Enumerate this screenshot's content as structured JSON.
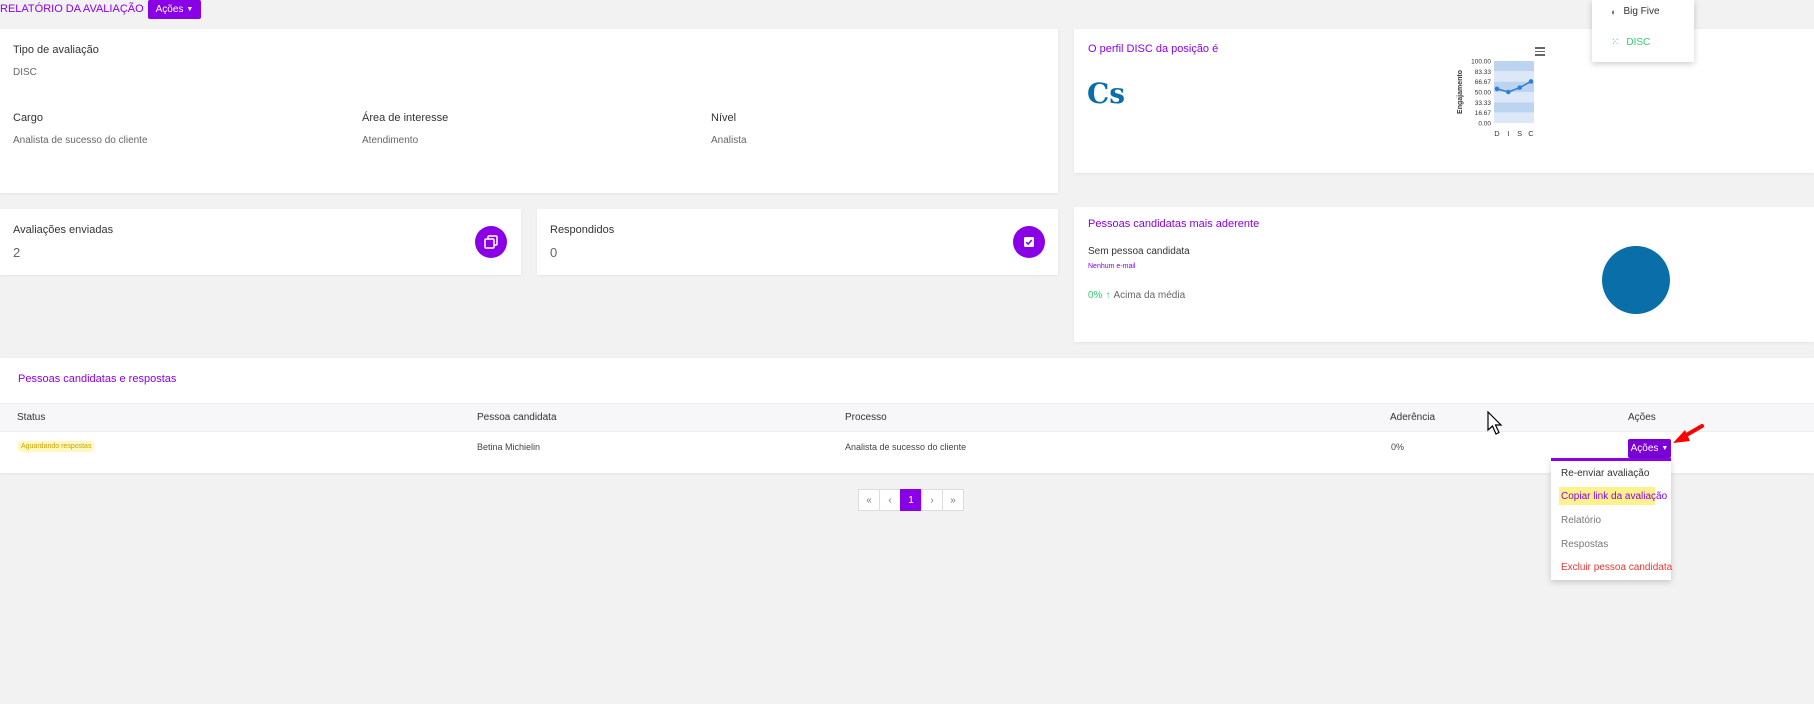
{
  "header": {
    "title": "RELATÓRIO DA AVALIAÇÃO",
    "actions_label": "Ações"
  },
  "info": {
    "tipo_label": "Tipo de avaliação",
    "tipo_value": "DISC",
    "cargo_label": "Cargo",
    "cargo_value": "Analista de sucesso do cliente",
    "area_label": "Área de interesse",
    "area_value": "Atendimento",
    "nivel_label": "Nível",
    "nivel_value": "Analista"
  },
  "disc_card": {
    "title": "O perfil DISC da posição é",
    "profile": "Cs",
    "chart_data": {
      "type": "line",
      "categories": [
        "D",
        "I",
        "S",
        "C"
      ],
      "values": [
        55,
        50,
        57,
        67
      ],
      "ylabel": "Engajamento",
      "yticks": [
        "100.00",
        "83.33",
        "66.67",
        "50.00",
        "33.33",
        "16.67",
        "0.00"
      ],
      "ylim": [
        0,
        100
      ]
    }
  },
  "type_menu": {
    "items": [
      "Big Five",
      "DISC"
    ]
  },
  "stats": {
    "enviadas_label": "Avaliações enviadas",
    "enviadas_value": "2",
    "respondidos_label": "Respondidos",
    "respondidos_value": "0"
  },
  "aderente": {
    "title": "Pessoas candidatas mais aderente",
    "name": "Sem pessoa candidata",
    "email": "Nenhum e-mail",
    "percent": "0%",
    "arrow": "↑",
    "comparison": "Acima da média"
  },
  "table": {
    "title": "Pessoas candidatas e respostas",
    "headers": [
      "Status",
      "Pessoa candidata",
      "Processo",
      "Aderência",
      "Ações"
    ],
    "row": {
      "status": "Aguardando respostas",
      "name": "Betina Michielin",
      "process": "Analista de sucesso do cliente",
      "adherence": "0%",
      "actions_label": "Ações"
    }
  },
  "pagination": {
    "first": "«",
    "prev": "‹",
    "current": "1",
    "next": "›",
    "last": "»"
  },
  "row_menu": {
    "items": [
      "Re-enviar avaliação",
      "Copiar link da avaliação",
      "Relatório",
      "Respostas",
      "Excluir pessoa candidata"
    ]
  },
  "colors": {
    "accent": "#8a00e6",
    "blue": "#0a6ea8",
    "danger": "#e53935",
    "highlight": "#fff28a",
    "success": "#2ecc71"
  }
}
